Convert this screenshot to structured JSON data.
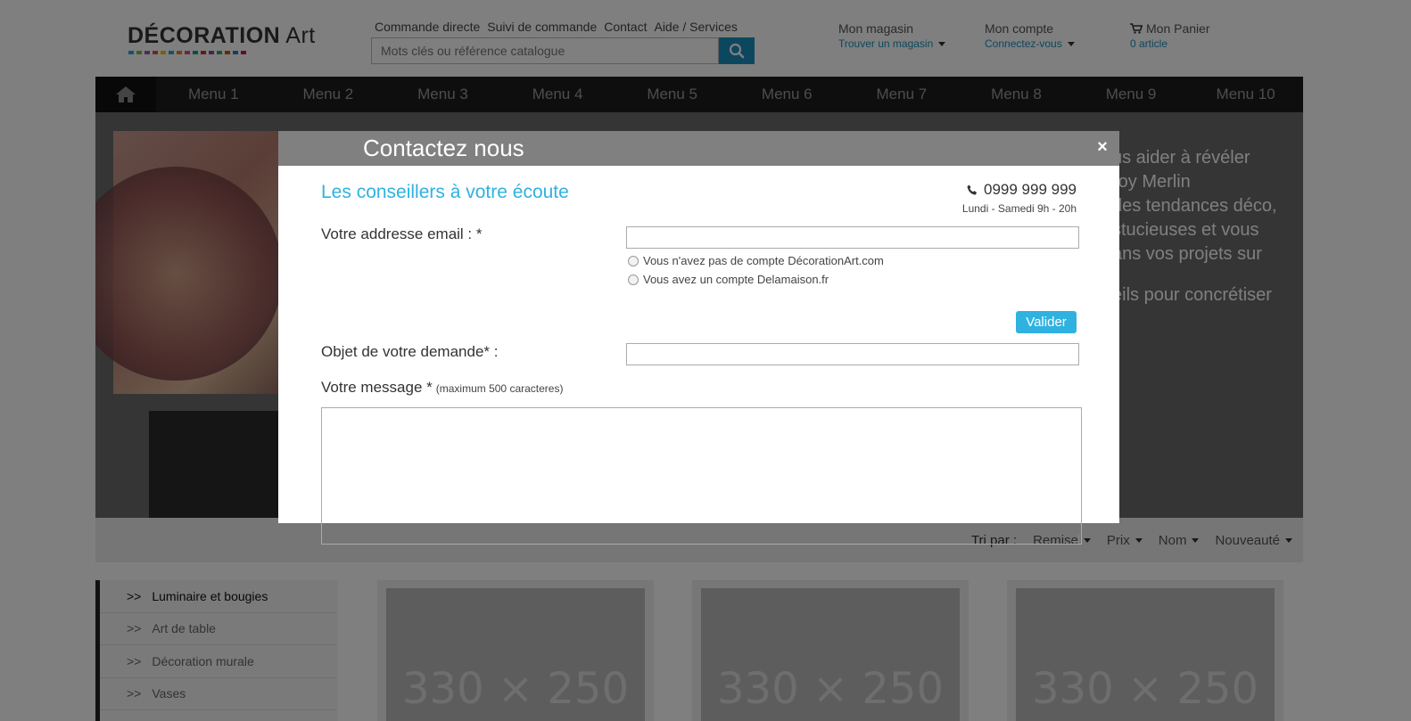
{
  "header": {
    "logo": {
      "main": "DÉCORATION",
      "accent": "Art"
    },
    "logo_dot_colors": [
      "#2aa7d6",
      "#7ac143",
      "#9b59b6",
      "#e74c3c",
      "#f1c40f",
      "#2aa7d6",
      "#e67e22",
      "#e84393",
      "#16a085",
      "#c0392b",
      "#8e44ad",
      "#27ae60",
      "#d35400",
      "#2980b9",
      "#c2185b"
    ],
    "top_links": [
      "Commande directe",
      "Suivi de commande",
      "Contact",
      "Aide / Services"
    ],
    "search": {
      "placeholder": "Mots clés ou référence catalogue",
      "icon": "search-icon"
    },
    "store": {
      "label": "Mon magasin",
      "link": "Trouver un magasin"
    },
    "account": {
      "label": "Mon compte",
      "link": "Connectez-vous"
    },
    "cart": {
      "label": "Mon Panier",
      "count": "0 article",
      "icon": "cart-icon"
    }
  },
  "nav": {
    "home_icon": "home-icon",
    "items": [
      "Menu 1",
      "Menu 2",
      "Menu 3",
      "Menu 4",
      "Menu 5",
      "Menu 6",
      "Menu 7",
      "Menu 8",
      "Menu 9",
      "Menu 10"
    ]
  },
  "hero": {
    "lines": [
      "us aider à révéler",
      "roy Merlin",
      "des tendances déco,",
      "stucieuses et vous",
      "ans vos projets sur",
      "",
      "eils pour concrétiser"
    ]
  },
  "sort": {
    "label": "Tri par :",
    "options": [
      "Remise",
      "Prix",
      "Nom",
      "Nouveauté"
    ]
  },
  "sidebar": {
    "items": [
      {
        "label": "Luminaire et bougies",
        "arrow": ">>"
      },
      {
        "label": "Art de table",
        "arrow": ">>"
      },
      {
        "label": "Décoration murale",
        "arrow": ">>"
      },
      {
        "label": "Vases",
        "arrow": ">>"
      }
    ]
  },
  "products": [
    {
      "placeholder": "330 × 250"
    },
    {
      "placeholder": "330 × 250"
    },
    {
      "placeholder": "330 × 250"
    }
  ],
  "modal": {
    "title": "Contactez nous",
    "close_icon": "close-icon",
    "subtitle": "Les conseillers à votre écoute",
    "phone": {
      "number": "0999 999 999",
      "hours": "Lundi - Samedi 9h - 20h",
      "icon": "phone-icon"
    },
    "email_label": "Votre addresse email : *",
    "email_value": "",
    "radio_no_account": "Vous n'avez pas de compte DécorationArt.com",
    "radio_account": "Vous avez un compte Delamaison.fr",
    "valider": "Valider",
    "objet_label": "Objet de votre demande* :",
    "objet_value": "",
    "message_label": "Votre message *",
    "message_hint": "(maximum 500 caracteres)",
    "message_value": ""
  },
  "colors": {
    "accent": "#2fb2e0",
    "link": "#1a8fbf",
    "nav_bg": "#1d1d1d",
    "modal_header": "#808080"
  }
}
